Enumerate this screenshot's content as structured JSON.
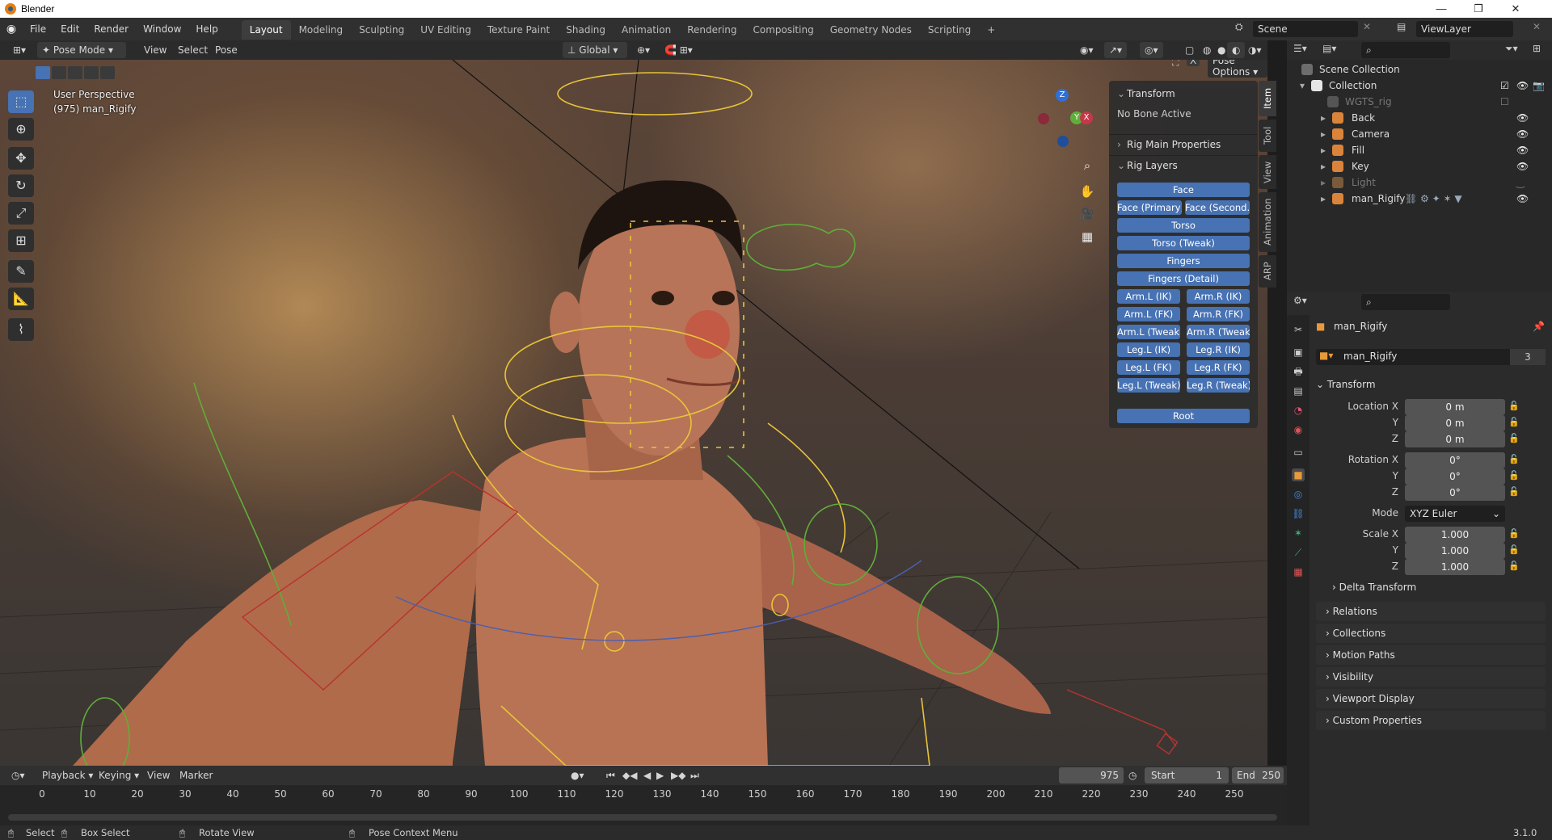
{
  "window": {
    "title": "Blender"
  },
  "menu": [
    "File",
    "Edit",
    "Render",
    "Window",
    "Help"
  ],
  "workspaces": [
    "Layout",
    "Modeling",
    "Sculpting",
    "UV Editing",
    "Texture Paint",
    "Shading",
    "Animation",
    "Rendering",
    "Compositing",
    "Geometry Nodes",
    "Scripting",
    "+"
  ],
  "scene": {
    "name": "Scene",
    "view_layer": "ViewLayer"
  },
  "viewport_header": {
    "mode": "Pose Mode",
    "menus": [
      "View",
      "Select",
      "Pose"
    ],
    "orientation": "Global",
    "pose_options": "Pose Options"
  },
  "viewport": {
    "perspective": "User Perspective",
    "object_info": "(975) man_Rigify"
  },
  "gizmo": {
    "z": "Z",
    "y": "Y",
    "x": "X"
  },
  "npanel": {
    "transform_title": "Transform",
    "no_bone": "No Bone Active",
    "rig_main": "Rig Main Properties",
    "rig_layers": "Rig Layers",
    "buttons_full": [
      "Face",
      "Torso",
      "Torso (Tweak)",
      "Fingers",
      "Fingers (Detail)"
    ],
    "face_row": [
      "Face (Primary)",
      "Face (Second..."
    ],
    "pairs": [
      [
        "Arm.L (IK)",
        "Arm.R (IK)"
      ],
      [
        "Arm.L (FK)",
        "Arm.R (FK)"
      ],
      [
        "Arm.L (Tweak)",
        "Arm.R (Tweak)"
      ],
      [
        "Leg.L (IK)",
        "Leg.R (IK)"
      ],
      [
        "Leg.L (FK)",
        "Leg.R (FK)"
      ],
      [
        "Leg.L (Tweak)",
        "Leg.R (Tweak)"
      ]
    ],
    "root": "Root",
    "tabs": [
      "Item",
      "Tool",
      "View",
      "Animation",
      "ARP"
    ]
  },
  "outliner": {
    "scene_collection": "Scene Collection",
    "collection": "Collection",
    "items": [
      "WGTS_rig",
      "Back",
      "Camera",
      "Fill",
      "Key",
      "Light",
      "man_Rigify"
    ]
  },
  "properties": {
    "object_name": "man_Rigify",
    "data_name": "man_Rigify",
    "users": "3",
    "transform": "Transform",
    "location_label": "Location X",
    "rotation_label": "Rotation X",
    "scale_label": "Scale X",
    "y": "Y",
    "z": "Z",
    "location": [
      "0 m",
      "0 m",
      "0 m"
    ],
    "rotation": [
      "0°",
      "0°",
      "0°"
    ],
    "mode_label": "Mode",
    "mode": "XYZ Euler",
    "scale": [
      "1.000",
      "1.000",
      "1.000"
    ],
    "sections": [
      "Delta Transform",
      "Relations",
      "Collections",
      "Motion Paths",
      "Visibility",
      "Viewport Display",
      "Custom Properties"
    ]
  },
  "timeline": {
    "menus": [
      "Playback",
      "Keying",
      "View",
      "Marker"
    ],
    "current_frame": "975",
    "start_label": "Start",
    "start": "1",
    "end_label": "End",
    "end": "250",
    "ticks": [
      "0",
      "10",
      "20",
      "30",
      "40",
      "50",
      "60",
      "70",
      "80",
      "90",
      "100",
      "110",
      "120",
      "130",
      "140",
      "150",
      "160",
      "170",
      "180",
      "190",
      "200",
      "210",
      "220",
      "230",
      "240",
      "250"
    ]
  },
  "status": {
    "select": "Select",
    "box_select": "Box Select",
    "rotate": "Rotate View",
    "context": "Pose Context Menu",
    "version": "3.1.0"
  },
  "colors": {
    "accent": "#4772b3",
    "bone_yellow": "#e8c43a",
    "bone_green": "#5fae3a",
    "bone_red": "#b8332f"
  }
}
